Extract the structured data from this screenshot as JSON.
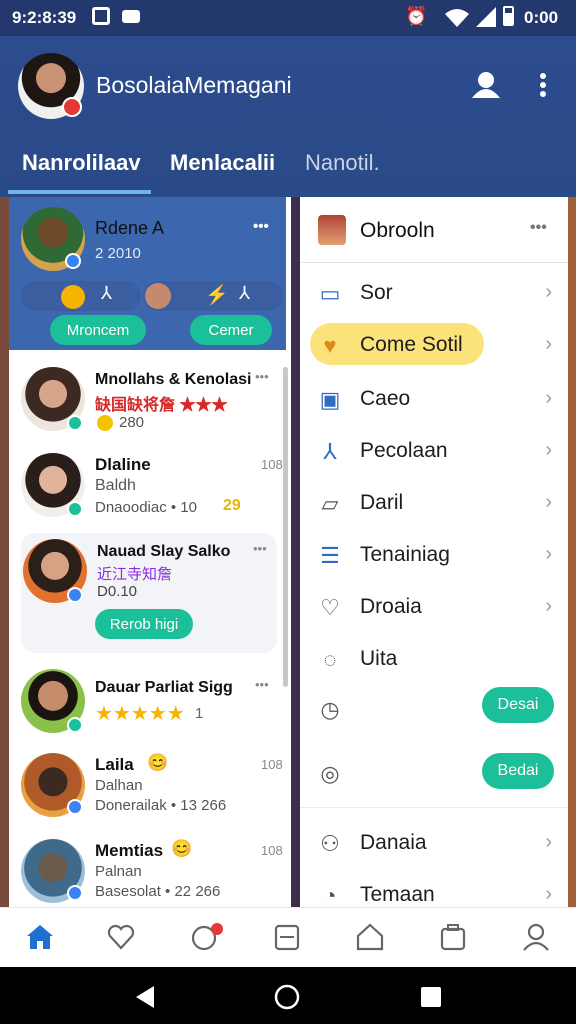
{
  "status": {
    "time": "9:2:8:39",
    "clock": "0:00"
  },
  "header": {
    "title": "BosolaiaMemagani"
  },
  "tabs": [
    "Nanrolilaav",
    "Menlacalii",
    "Nanotil."
  ],
  "featured": {
    "name": "Rdene A",
    "meta": "2 2010",
    "btn_left": "Mroncem",
    "btn_right": "Cemer",
    "more": "•••"
  },
  "chats": [
    {
      "name": "Mnollahs & Kenolasi",
      "line2": "缺国缺将詹 ★★★",
      "line3": "280",
      "time": "•••"
    },
    {
      "name": "Dlaline",
      "line2": "Baldh",
      "line3": "Dnaoodiac • 10",
      "extra": "29",
      "time": "108"
    },
    {
      "name": "Nauad Slay Salko",
      "line2": "近江寺知詹",
      "line3": "D0.10",
      "button": "Rerob higi",
      "time": "•••"
    },
    {
      "name": "Dauar Parliat Sigg",
      "line2": "★★★★★",
      "line3": "1",
      "time": "•••"
    },
    {
      "name": "Laila",
      "line2": "Dalhan",
      "line3": "Donerailak • 13 266",
      "time": "108"
    },
    {
      "name": "Memtias",
      "line2": "Palnan",
      "line3": "Basesolat • 22 266",
      "time": "108"
    }
  ],
  "menu": {
    "header": "Obrooln",
    "more": "•••",
    "items": [
      "Sor",
      "Come Sotil",
      "Caeo",
      "Pecolaan",
      "Daril",
      "Tenainiag",
      "Droaia",
      "Uita",
      "",
      "",
      "Danaia",
      "Temaan"
    ],
    "btn1": "Desai",
    "btn2": "Bedai"
  },
  "colors": {
    "appbar": "#2d4c8e",
    "accent": "#1bbf9a",
    "highlight": "#fbe27a"
  }
}
